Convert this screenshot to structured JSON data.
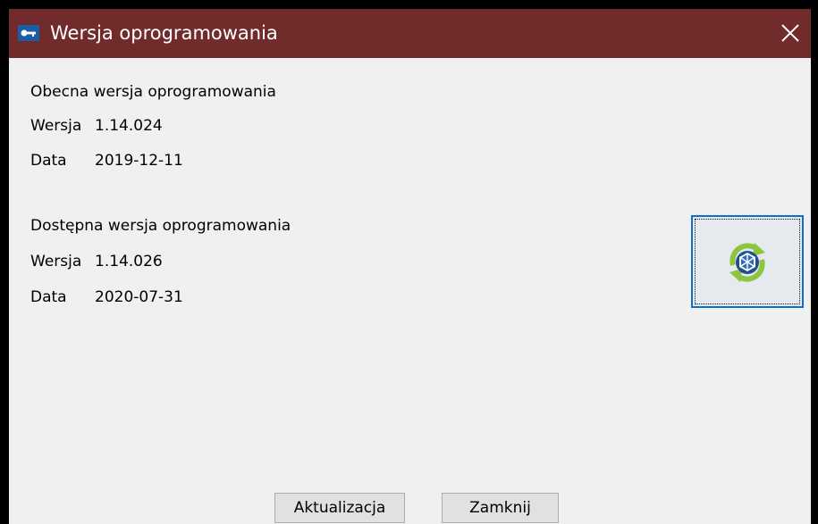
{
  "window": {
    "title": "Wersja oprogramowania",
    "title_bar_color": "#722b2b",
    "icons": {
      "app": "key-icon",
      "close": "close-icon"
    }
  },
  "current": {
    "heading": "Obecna wersja oprogramowania",
    "version_label": "Wersja",
    "version_value": "1.14.024",
    "date_label": "Data",
    "date_value": "2019-12-11"
  },
  "available": {
    "heading": "Dostępna wersja oprogramowania",
    "version_label": "Wersja",
    "version_value": "1.14.026",
    "date_label": "Data",
    "date_value": "2020-07-31"
  },
  "update_icon": "refresh-cube-icon",
  "buttons": {
    "update_label": "Aktualizacja",
    "close_label": "Zamknij"
  }
}
